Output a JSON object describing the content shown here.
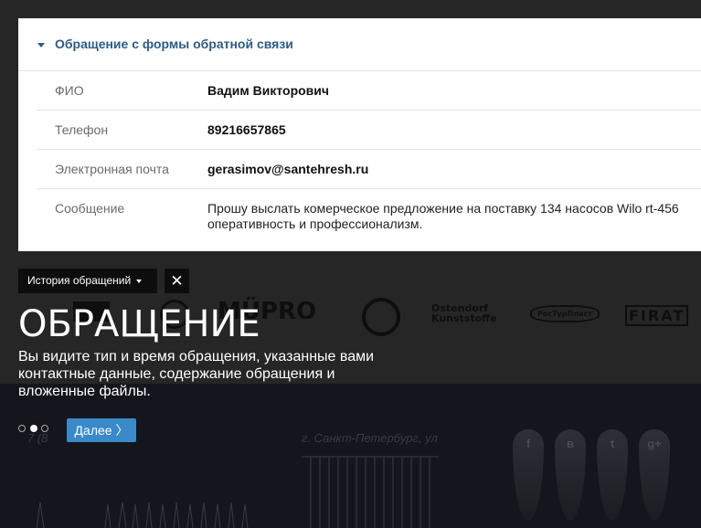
{
  "form_card": {
    "title": "Обращение с формы обратной связи",
    "rows": [
      {
        "label": "ФИО",
        "value": "Вадим Викторович"
      },
      {
        "label": "Телефон",
        "value": "89216657865"
      },
      {
        "label": "Электронная почта",
        "value": "gerasimov@santehresh.ru"
      },
      {
        "label": "Сообщение",
        "value_line1": "Прошу выслать комерческое предложение на поставку 134 насосов Wilo rt-456",
        "value_line2": "оперативность и профессионализм."
      }
    ]
  },
  "toolbar": {
    "history_label": "История обращений",
    "close_label": "✕"
  },
  "tour": {
    "title": "ОБРАЩЕНИЕ",
    "description": "Вы видите тип и время обращения, указанные вами контактные данные, содержание обращения и вложенные файлы.",
    "next_label": "Далее 〉",
    "steps_total": 3,
    "step_current": 2
  },
  "background": {
    "logos": [
      "MÜPRO",
      "Ostendorf Kunststoffe",
      "РосТурПласт",
      "FIRAT"
    ],
    "address_text": "г. Санкт-Петербург, ул",
    "phone_fragment": "7 (8",
    "social_icons": [
      "facebook-icon",
      "vk-icon",
      "twitter-icon",
      "google-plus-icon"
    ],
    "social_glyphs": [
      "f",
      "в",
      "t",
      "g+"
    ]
  },
  "colors": {
    "accent_blue": "#2d5b86",
    "button_blue": "#3a8ac9"
  }
}
